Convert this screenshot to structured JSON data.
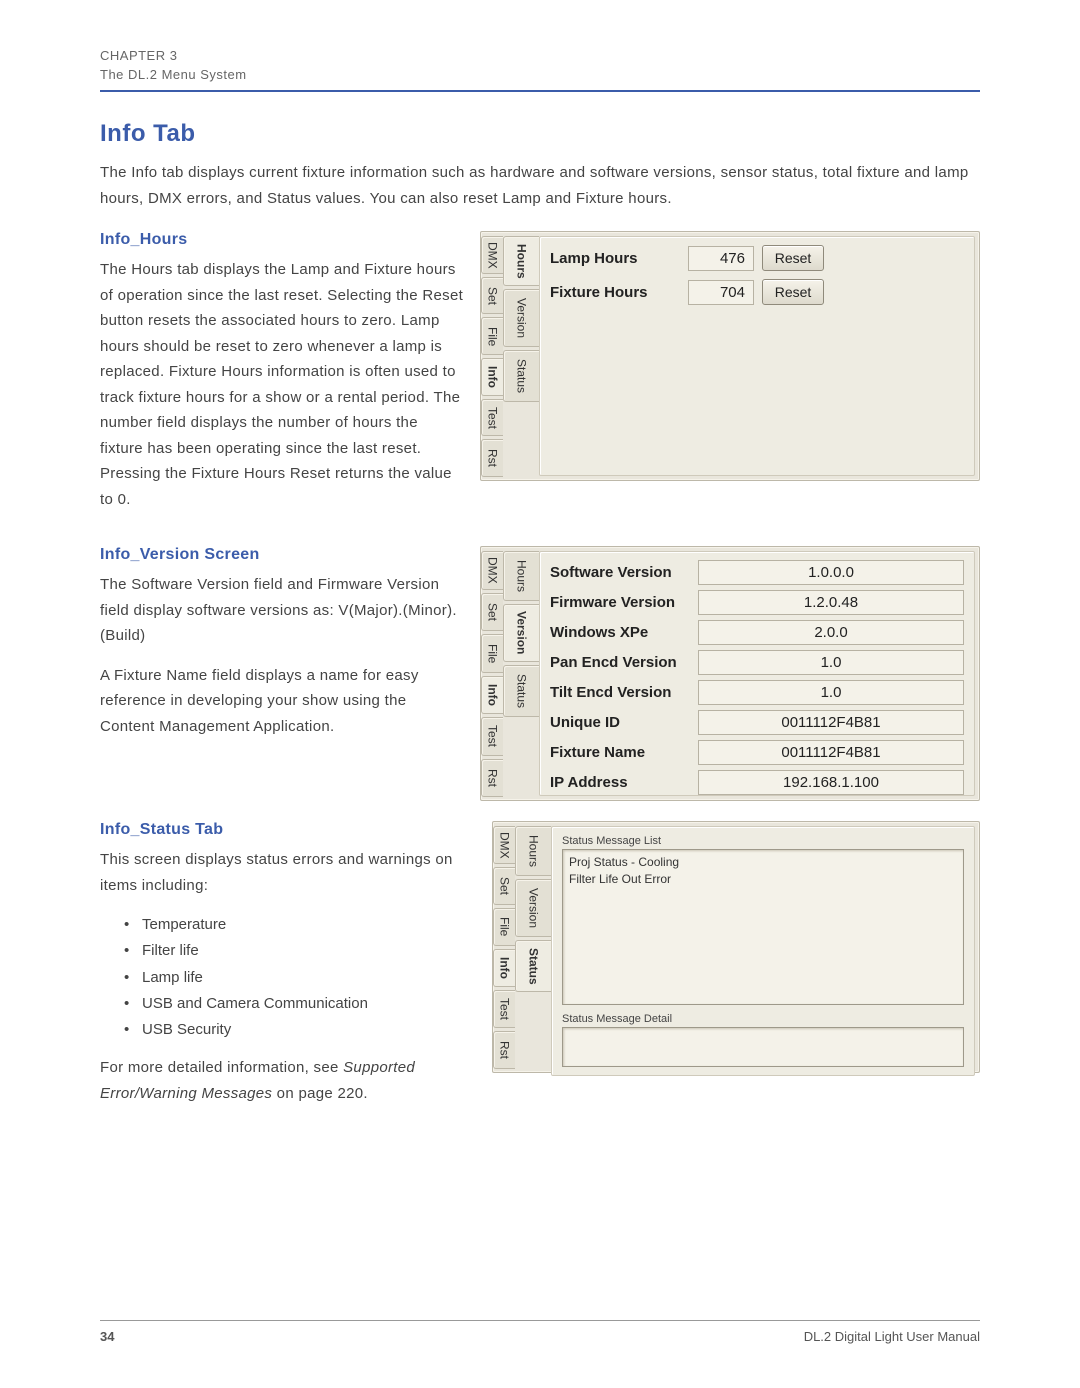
{
  "header": {
    "chapter": "CHAPTER 3",
    "title": "The DL.2 Menu System"
  },
  "h1": "Info Tab",
  "intro": "The Info tab displays current fixture information such as hardware and software versions, sensor status, total fixture and lamp hours, DMX errors, and Status values. You can also reset Lamp and Fixture hours.",
  "hours": {
    "heading": "Info_Hours",
    "body": "The Hours tab displays the Lamp and Fixture hours of operation since the last reset. Selecting the Reset button resets the associated hours to zero. Lamp hours should be reset to zero whenever a lamp is replaced. Fixture Hours information is often used to track fixture hours for a show or a rental period. The number field displays the number of hours the fixture has been operating since the last reset. Pressing the Fixture Hours Reset returns the value to 0."
  },
  "version": {
    "heading": "Info_Version Screen",
    "body1": "The Software Version field and Firmware Version field display software versions as: V(Major).(Minor).(Build)",
    "body2": "A Fixture Name field displays a name for easy reference in developing your show using the Content Management Application."
  },
  "status": {
    "heading": "Info_Status Tab",
    "body1": "This screen displays status errors and warnings on items including:",
    "bullets": [
      "Temperature",
      "Filter life",
      "Lamp life",
      "USB and Camera Communication",
      "USB Security"
    ],
    "body2a": "For more detailed information, see ",
    "body2b": "Supported Error/Warning Messages",
    "body2c": " on page 220."
  },
  "panel_outer_tabs": [
    "DMX",
    "Set",
    "File",
    "Info",
    "Test",
    "Rst"
  ],
  "panel_outer_selected": "Info",
  "panel_inner_tabs": [
    "Hours",
    "Version",
    "Status"
  ],
  "panel_hours": {
    "inner_selected": "Hours",
    "rows": [
      {
        "label": "Lamp Hours",
        "value": "476",
        "button": "Reset"
      },
      {
        "label": "Fixture Hours",
        "value": "704",
        "button": "Reset"
      }
    ]
  },
  "panel_version": {
    "inner_selected": "Version",
    "rows": [
      {
        "label": "Software Version",
        "value": "1.0.0.0"
      },
      {
        "label": "Firmware Version",
        "value": "1.2.0.48"
      },
      {
        "label": "Windows XPe",
        "value": "2.0.0"
      },
      {
        "label": "Pan Encd Version",
        "value": "1.0"
      },
      {
        "label": "Tilt Encd Version",
        "value": "1.0"
      },
      {
        "label": "Unique ID",
        "value": "0011112F4B81"
      },
      {
        "label": "Fixture Name",
        "value": "0011112F4B81"
      },
      {
        "label": "IP Address",
        "value": "192.168.1.100"
      }
    ]
  },
  "panel_status": {
    "inner_selected": "Status",
    "list_label": "Status Message List",
    "list_items": [
      "Proj Status - Cooling",
      "Filter Life Out Error"
    ],
    "detail_label": "Status Message Detail"
  },
  "footer": {
    "page": "34",
    "doc": "DL.2 Digital Light User Manual"
  }
}
